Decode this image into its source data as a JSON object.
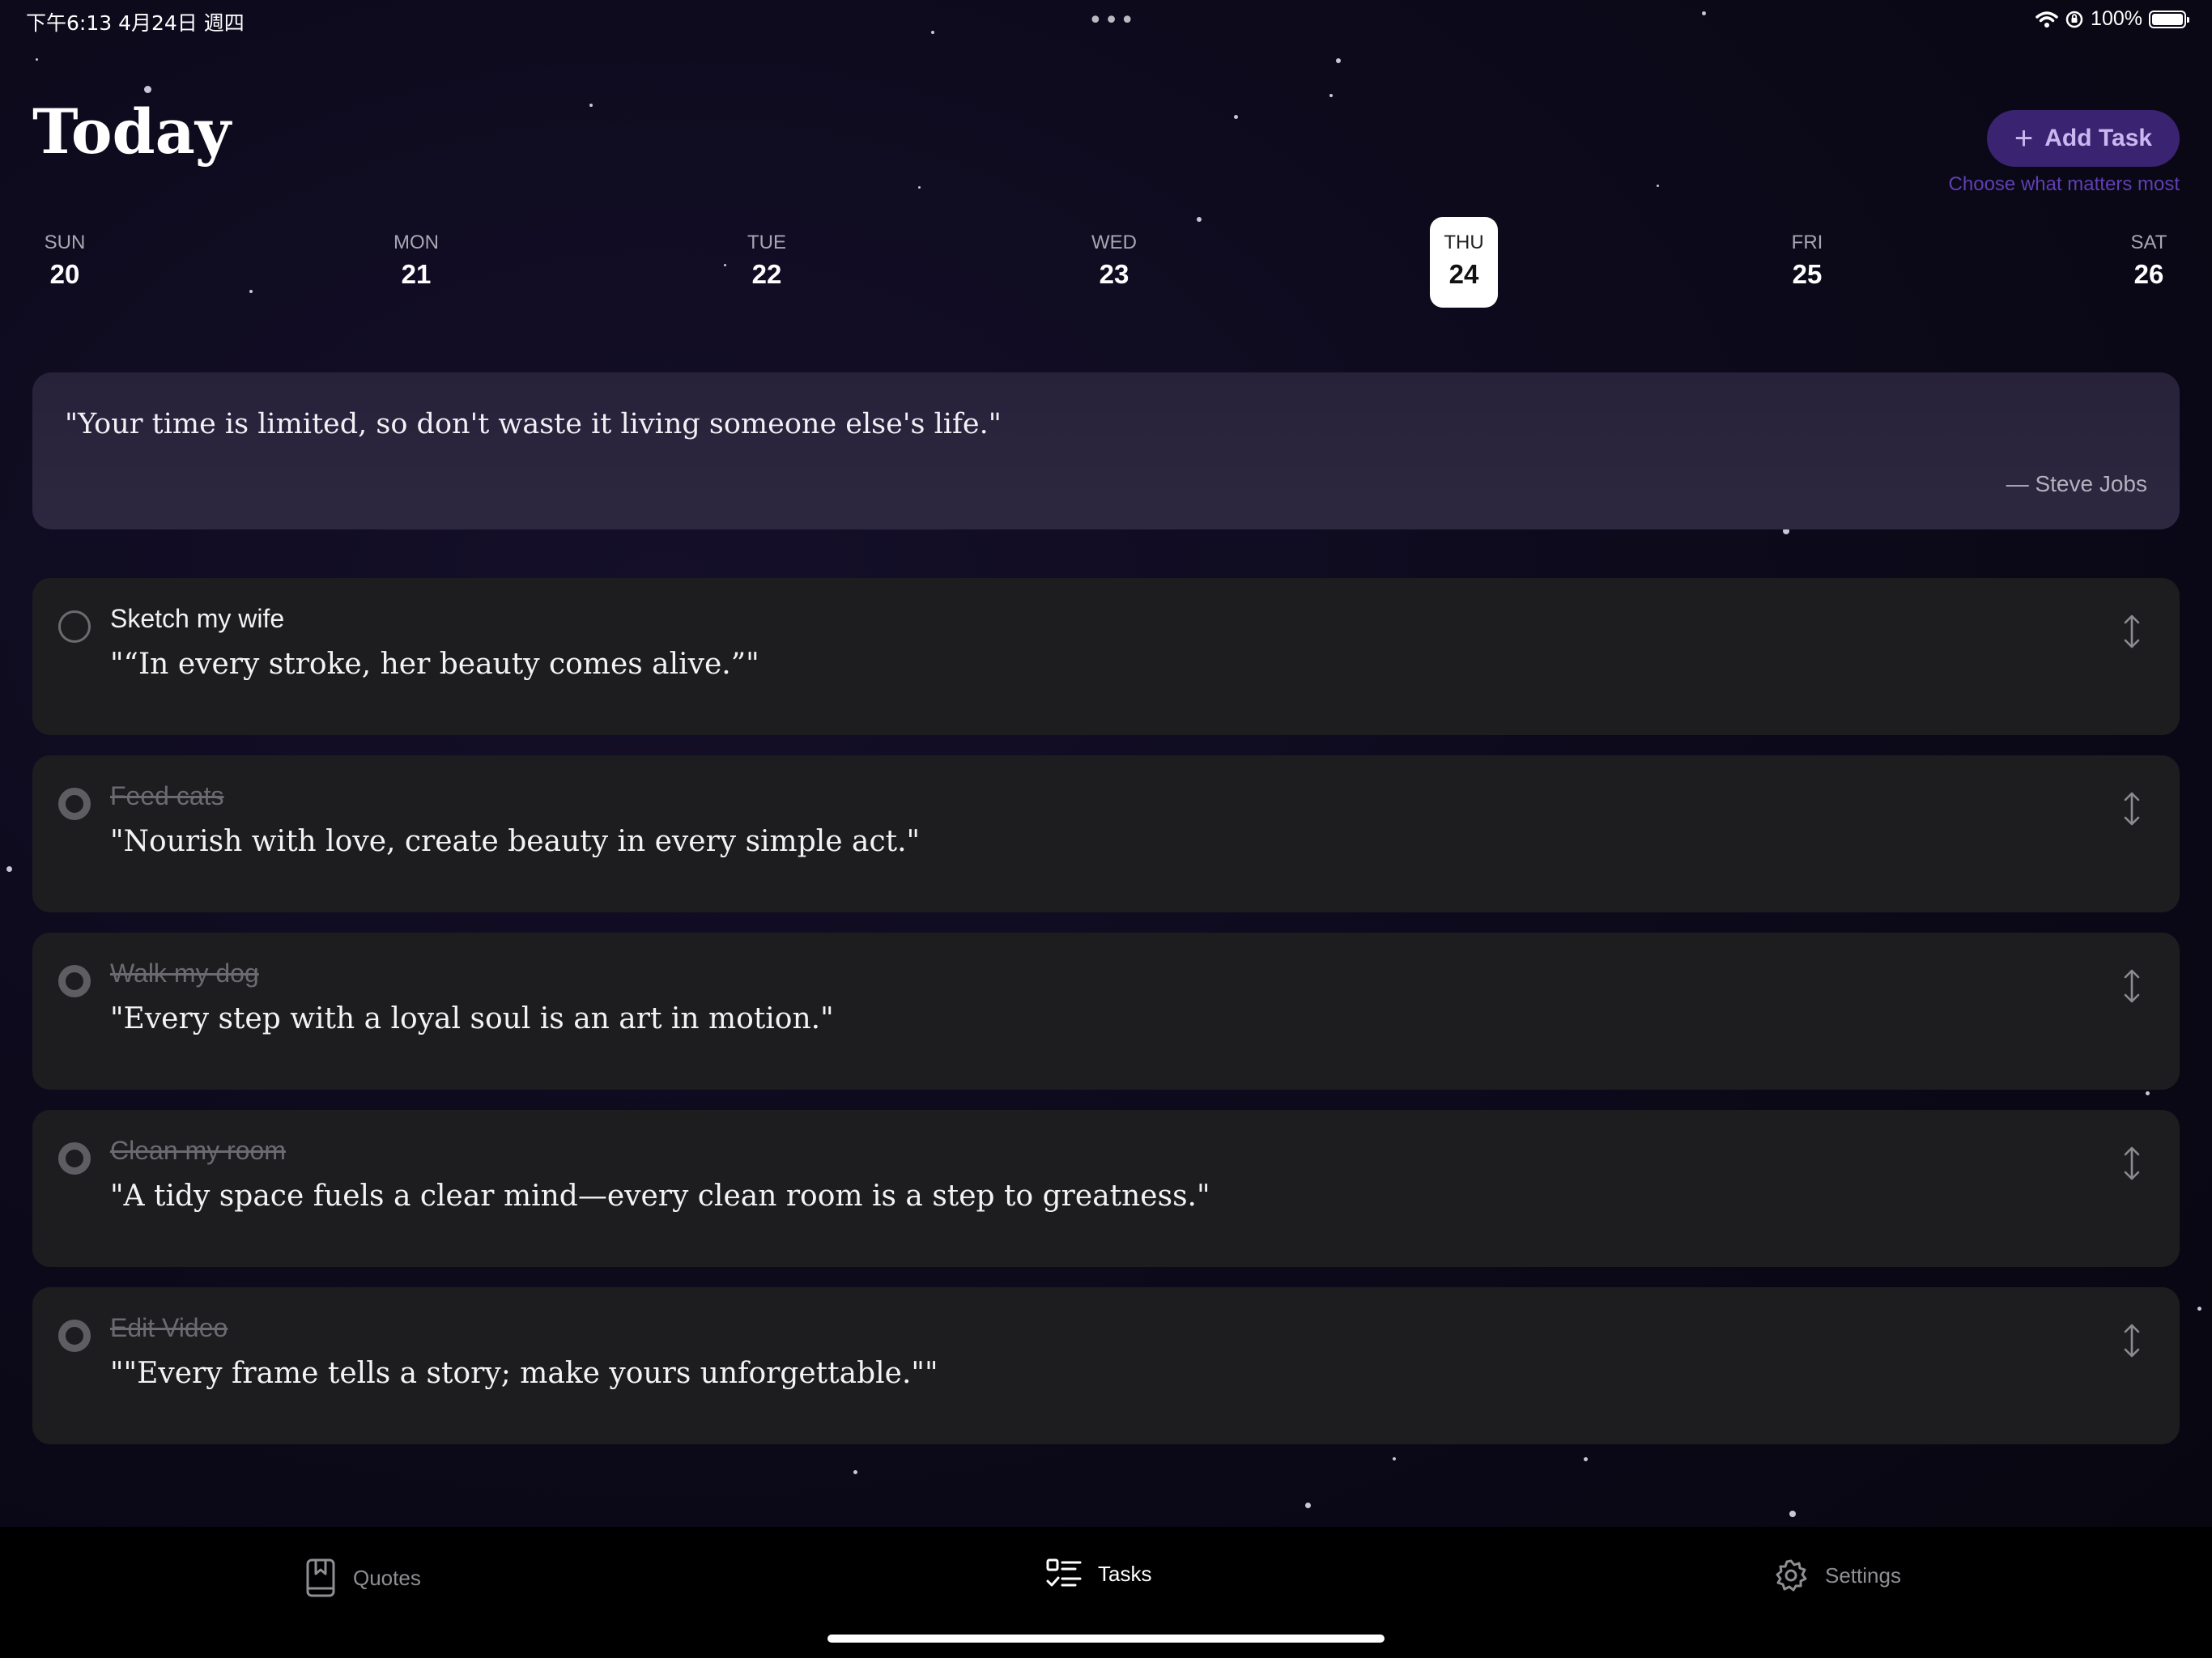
{
  "status_bar": {
    "time_date": "下午6:13   4月24日 週四",
    "multitask": "•••",
    "battery": "100%"
  },
  "header": {
    "title": "Today",
    "add_task_label": "Add Task",
    "tagline": "Choose what matters most"
  },
  "week": [
    {
      "day": "SUN",
      "date": "20"
    },
    {
      "day": "MON",
      "date": "21"
    },
    {
      "day": "TUE",
      "date": "22"
    },
    {
      "day": "WED",
      "date": "23"
    },
    {
      "day": "THU",
      "date": "24"
    },
    {
      "day": "FRI",
      "date": "25"
    },
    {
      "day": "SAT",
      "date": "26"
    }
  ],
  "selected_day": "THU",
  "daily_quote": {
    "text": "\"Your time is limited, so don't waste it living someone else's life.\"",
    "author": "— Steve Jobs"
  },
  "tasks": [
    {
      "title": "Sketch my wife",
      "quote": "\"“In every stroke, her beauty comes alive.”\"",
      "completed": false
    },
    {
      "title": "Feed cats",
      "quote": "\"Nourish with love, create beauty in every simple act.\"",
      "completed": true
    },
    {
      "title": "Walk my dog",
      "quote": "\"Every step with a loyal soul is an art in motion.\"",
      "completed": true
    },
    {
      "title": "Clean my room",
      "quote": "\"A tidy space fuels a clear mind—every clean room is a step to greatness.\"",
      "completed": true
    },
    {
      "title": "Edit Video",
      "quote": "\"\"Every frame tells a story; make yours unforgettable.\"\"",
      "completed": true
    }
  ],
  "tab_bar": {
    "quotes": "Quotes",
    "tasks": "Tasks",
    "settings": "Settings",
    "active": "tasks"
  },
  "colors": {
    "accent": "#3a2370",
    "accent_text": "#5f3fb4",
    "card": "#1d1d1f",
    "quote_card": "#2a2440"
  }
}
